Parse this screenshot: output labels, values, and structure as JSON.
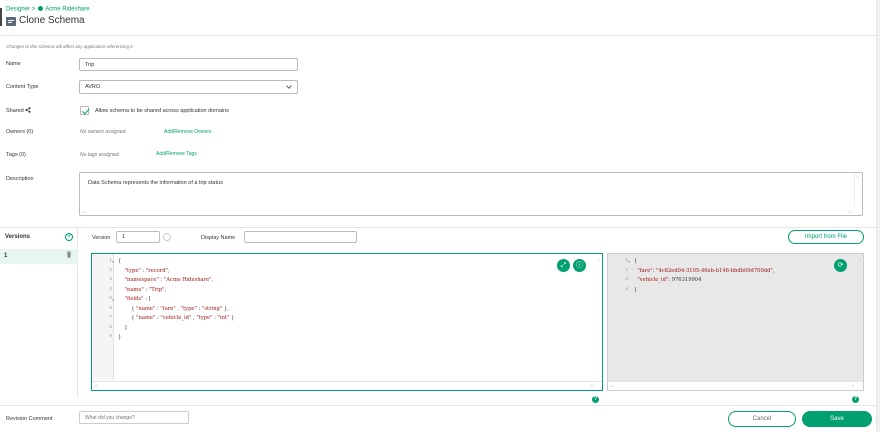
{
  "breadcrumb": {
    "root": "Designer",
    "sep": ">",
    "app": "Acme Rideshare"
  },
  "page_title": "Clone Schema",
  "warning": "Changes to this schema will affect any application referencing it.",
  "form": {
    "name": {
      "label": "Name",
      "value": "Trip"
    },
    "content_type": {
      "label": "Content Type",
      "value": "AVRO"
    },
    "shared": {
      "label": "Shared",
      "checkbox_label": "Allow schema to be shared across application domains",
      "checked": true
    },
    "owners": {
      "label": "Owners (0)",
      "empty_text": "No owners assigned.",
      "action": "Add/Remove Owners"
    },
    "tags": {
      "label": "Tags (0)",
      "empty_text": "No tags assigned.",
      "action": "Add/Remove Tags"
    },
    "description": {
      "label": "Description",
      "value": "Data Schema represents the information of a trip status"
    }
  },
  "versions": {
    "label": "Versions",
    "items": [
      {
        "label": "1"
      }
    ],
    "version_label": "Version",
    "version_value": "1",
    "display_name_label": "Display Name",
    "display_name_value": "",
    "import_button": "Import from File"
  },
  "schema_editor": {
    "lines": [
      {
        "n": "1",
        "text": "{"
      },
      {
        "n": "2",
        "text": "    \"type\" : \"record\","
      },
      {
        "n": "3",
        "text": "    \"namespace\" : \"Acme Rideshare\","
      },
      {
        "n": "4",
        "text": "    \"name\" : \"Trip\","
      },
      {
        "n": "5",
        "text": "    \"fields\" : ["
      },
      {
        "n": "6",
        "text": "        { \"name\" : \"fare\" , \"type\" : \"string\" },"
      },
      {
        "n": "7",
        "text": "        { \"name\" : \"vehicle_id\" , \"type\" : \"int\" }"
      },
      {
        "n": "8",
        "text": "    ]"
      },
      {
        "n": "9",
        "text": "}"
      }
    ]
  },
  "sample_editor": {
    "lines": [
      {
        "n": "1",
        "text": "{"
      },
      {
        "n": "2",
        "text": "  \"fare\": \"4c82ed04-3105-46eb-b146-bbdb09d700dd\","
      },
      {
        "n": "3",
        "text": "  \"vehicle_id\": 976319904"
      },
      {
        "n": "4",
        "text": "}"
      }
    ]
  },
  "revision": {
    "label": "Revision Comment",
    "placeholder": "What did you change?"
  },
  "actions": {
    "cancel": "Cancel",
    "save": "Save"
  },
  "icons": {
    "breadcrumb": "dot-icon",
    "title": "schema-icon",
    "share": "share-icon",
    "add_version": "plus-circle-icon",
    "delete_version": "trash-icon",
    "expand": "expand-icon",
    "info": "info-icon",
    "regenerate": "refresh-icon",
    "help": "help-icon"
  },
  "colors": {
    "accent": "#00a070",
    "selected_bg": "#e7f6ef",
    "string": "#a31515"
  }
}
